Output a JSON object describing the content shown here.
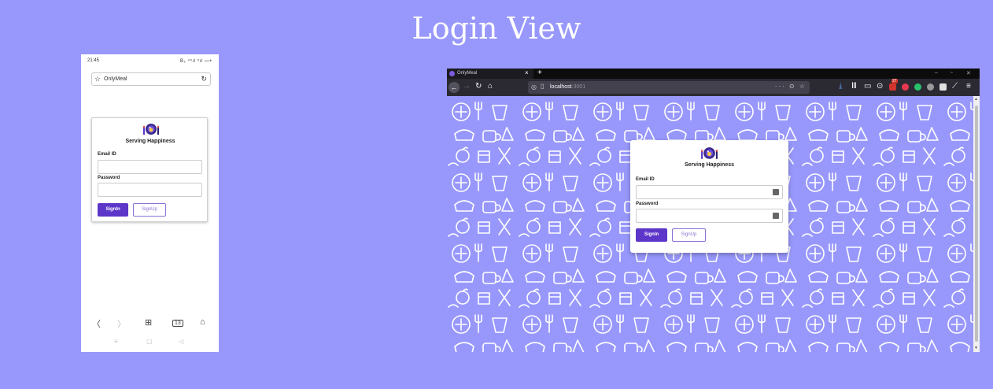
{
  "page": {
    "title": "Login View"
  },
  "mobile": {
    "status_time": "21:45",
    "status_icons": "B₂ ⁴⁵ıl ⁵ıl ▭+",
    "url_text": "OnlyMeal",
    "tagline": "Serving Happiness",
    "email_label": "Email ID",
    "password_label": "Password",
    "signin_label": "SignIn",
    "signup_label": "SignUp",
    "nav": {
      "back": "〈",
      "forward": "〉",
      "tabs_grid": "⊞",
      "tab_count": "13",
      "home": "⌂"
    },
    "sys": {
      "menu": "≡",
      "home": "▢",
      "back": "◁"
    }
  },
  "desktop": {
    "tab_title": "OnlyMeal",
    "tab_close": "×",
    "new_tab": "+",
    "address_host": "localhost",
    "address_port": ":3001",
    "address_actions": "··· ⊙ ☆",
    "tagline": "Serving Happiness",
    "email_label": "Email ID",
    "password_label": "Password",
    "signin_label": "SignIn",
    "signup_label": "SignUp",
    "badge_count": "27"
  },
  "colors": {
    "background": "#9898fc",
    "primary": "#5c35c9",
    "secondary": "#8b72d6"
  }
}
